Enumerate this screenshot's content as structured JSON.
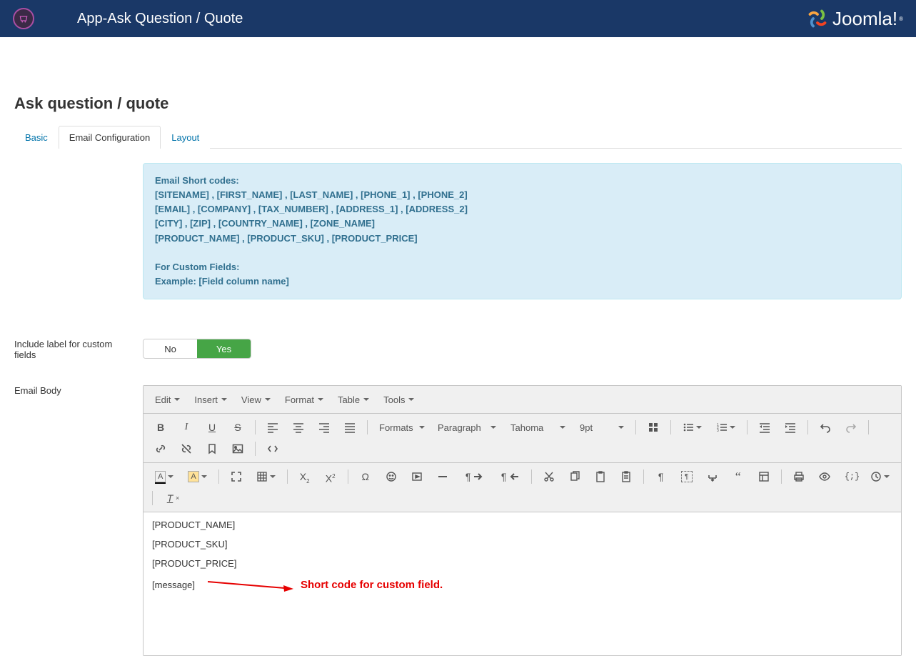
{
  "topbar": {
    "title": "App-Ask Question / Quote",
    "brand": "Joomla!"
  },
  "page_heading": "Ask question / quote",
  "tabs": {
    "basic": "Basic",
    "email": "Email Configuration",
    "layout": "Layout"
  },
  "shortcodes": {
    "heading": "Email Short codes:",
    "l1": "[SITENAME] , [FIRST_NAME] , [LAST_NAME] , [PHONE_1] , [PHONE_2]",
    "l2": "[EMAIL] , [COMPANY] , [TAX_NUMBER] , [ADDRESS_1] , [ADDRESS_2]",
    "l3": "[CITY] , [ZIP] , [COUNTRY_NAME] , [ZONE_NAME]",
    "l4": "[PRODUCT_NAME] , [PRODUCT_SKU] , [PRODUCT_PRICE]",
    "custom_h": "For Custom Fields:",
    "custom_ex": "Example: [Field column name]"
  },
  "field_include_label": "Include label for custom fields",
  "toggle": {
    "no": "No",
    "yes": "Yes",
    "value": "Yes"
  },
  "field_body_label": "Email Body",
  "menus": {
    "edit": "Edit",
    "insert": "Insert",
    "view": "View",
    "format": "Format",
    "table": "Table",
    "tools": "Tools"
  },
  "dd": {
    "formats": "Formats",
    "block": "Paragraph",
    "font": "Tahoma",
    "size": "9pt"
  },
  "body": {
    "p1": "[PRODUCT_NAME]",
    "p2": "[PRODUCT_SKU]",
    "p3": "[PRODUCT_PRICE]",
    "p4": "[message]"
  },
  "annotation": "Short code for custom field."
}
